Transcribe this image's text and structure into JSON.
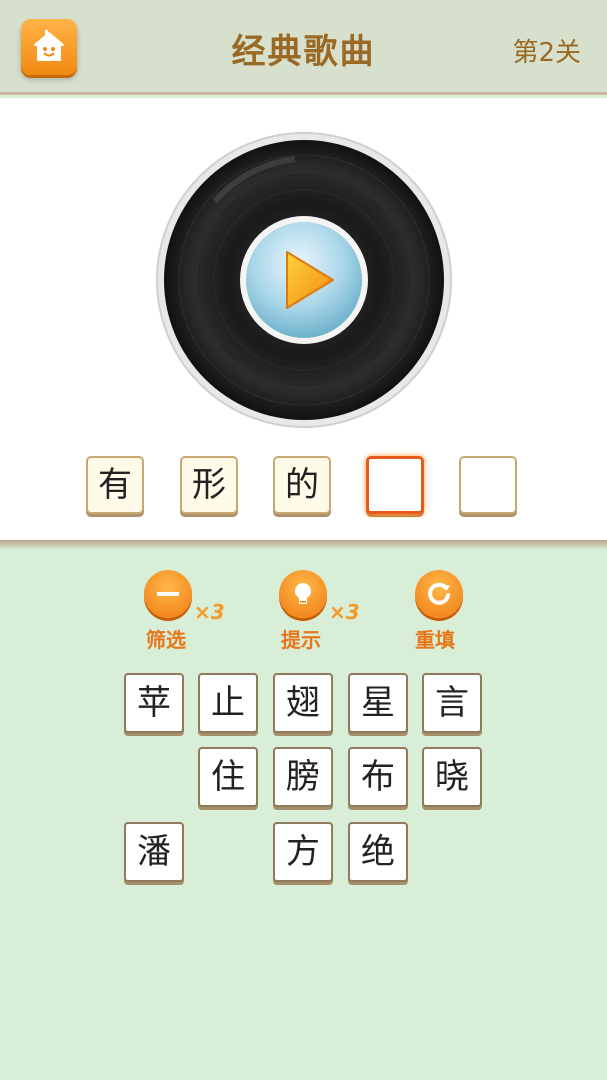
{
  "header": {
    "title": "经典歌曲",
    "level": "第2关",
    "home_icon": "home-icon"
  },
  "player": {
    "play_icon": "play-icon"
  },
  "answer": {
    "slots": [
      "有",
      "形",
      "的",
      "",
      ""
    ],
    "active_slot": 3
  },
  "tools": {
    "filter": {
      "label": "筛选",
      "count": "×3",
      "icon": "minus-icon"
    },
    "hint": {
      "label": "提示",
      "count": "×3",
      "icon": "lightbulb-icon"
    },
    "reset": {
      "label": "重填",
      "icon": "refresh-icon"
    }
  },
  "candidates": {
    "row1": [
      "苹",
      "止",
      "翅",
      "星",
      "言"
    ],
    "row2": [
      "住",
      "膀",
      "布",
      "晓"
    ],
    "row3": [
      "潘",
      "方",
      "绝"
    ]
  },
  "colors": {
    "accent": "#f28a12",
    "title": "#9a6a24",
    "background": "#d9eed6"
  }
}
